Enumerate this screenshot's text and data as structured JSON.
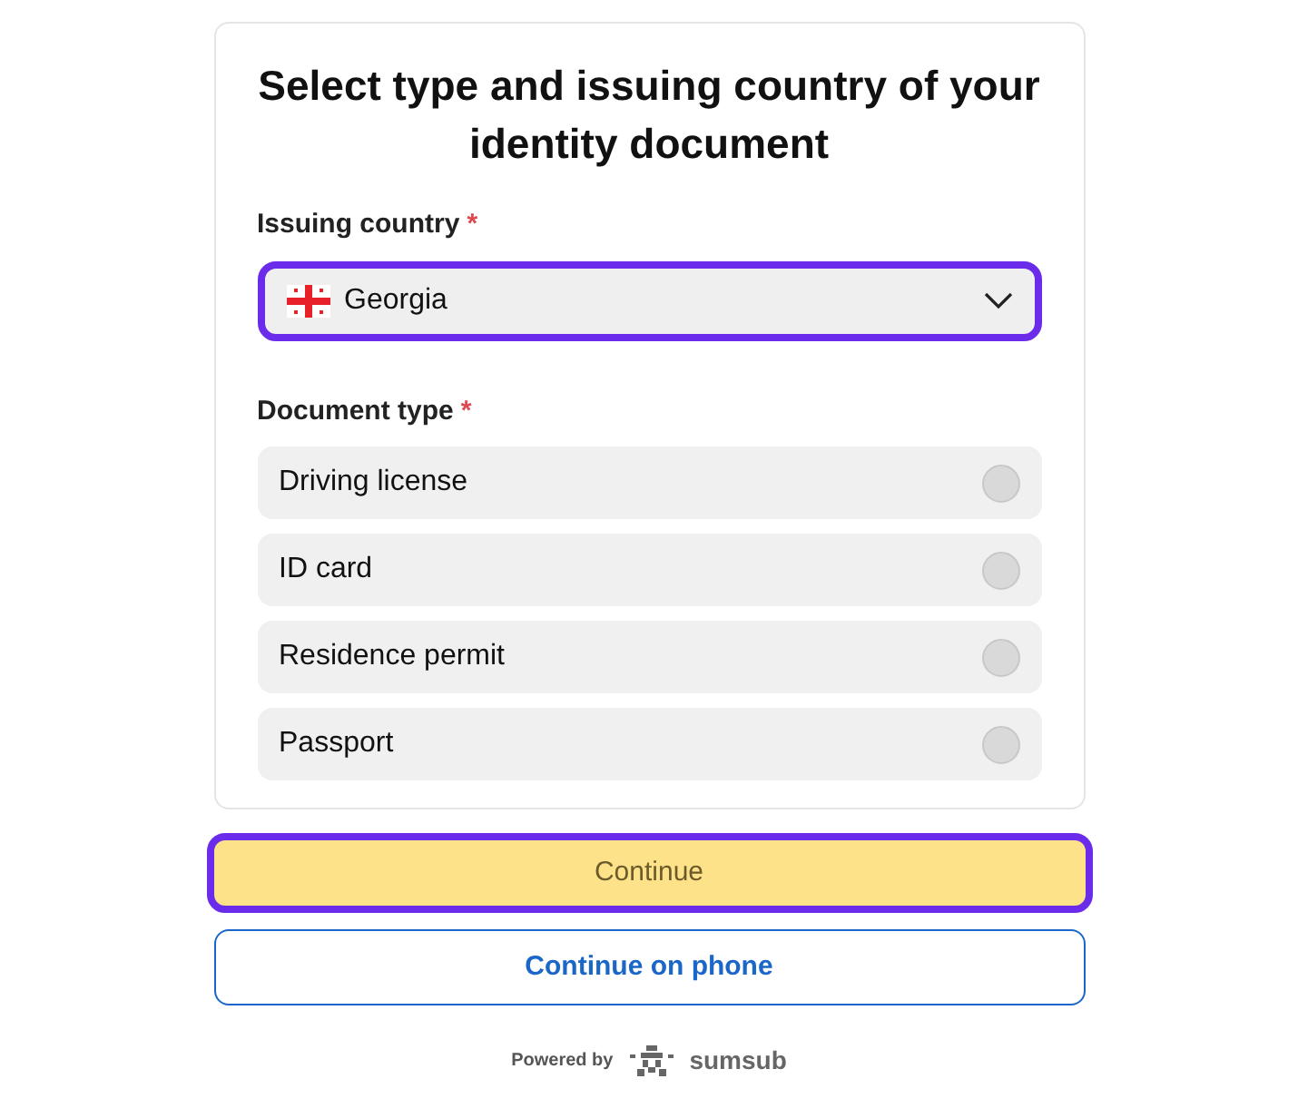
{
  "title": "Select type and issuing country of your identity document",
  "country": {
    "label": "Issuing country",
    "required_mark": "*",
    "value": "Georgia",
    "focused": true
  },
  "document_type": {
    "label": "Document type",
    "required_mark": "*",
    "options": [
      {
        "label": "Driving license",
        "selected": false
      },
      {
        "label": "ID card",
        "selected": false
      },
      {
        "label": "Residence permit",
        "selected": false
      },
      {
        "label": "Passport",
        "selected": false
      }
    ]
  },
  "continue_button": {
    "label": "Continue",
    "focused": true
  },
  "phone_button": {
    "label": "Continue on phone"
  },
  "footer": {
    "powered_by": "Powered by",
    "brand": "sumsub"
  }
}
